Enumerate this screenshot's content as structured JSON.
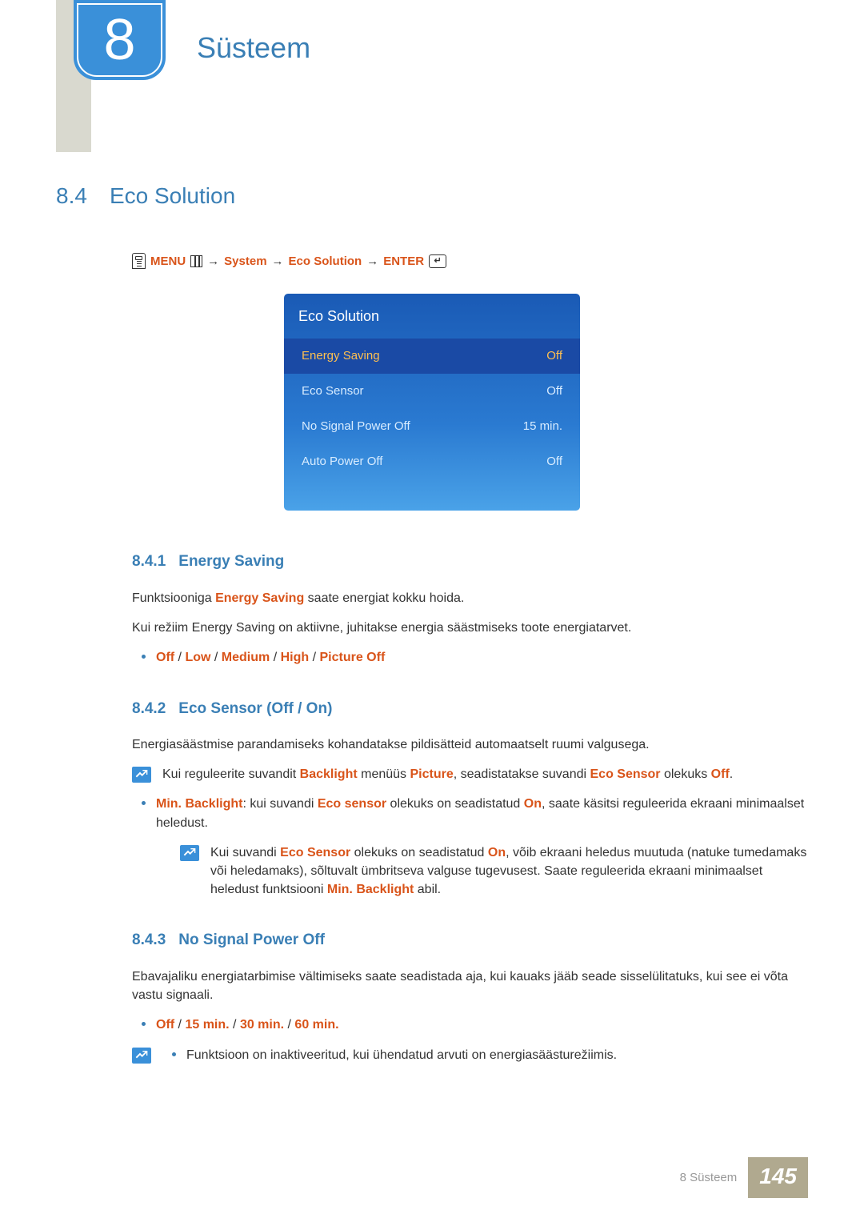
{
  "chapter": {
    "number": "8",
    "title": "Süsteem"
  },
  "section": {
    "number": "8.4",
    "title": "Eco Solution"
  },
  "menupath": {
    "menu": "MENU",
    "p1": "System",
    "p2": "Eco Solution",
    "enter": "ENTER",
    "arrow": "→"
  },
  "osd": {
    "title": "Eco Solution",
    "rows": [
      {
        "label": "Energy Saving",
        "value": "Off"
      },
      {
        "label": "Eco Sensor",
        "value": "Off"
      },
      {
        "label": "No Signal Power Off",
        "value": "15 min."
      },
      {
        "label": "Auto Power Off",
        "value": "Off"
      }
    ]
  },
  "s841": {
    "num": "8.4.1",
    "title": "Energy Saving",
    "p1a": "Funktsiooniga ",
    "p1b": "Energy Saving",
    "p1c": " saate energiat kokku hoida.",
    "p2": "Kui režiim Energy Saving on aktiivne, juhitakse energia säästmiseks toote energiatarvet.",
    "opt_off": "Off",
    "opt_low": "Low",
    "opt_medium": "Medium",
    "opt_high": "High",
    "opt_picoff": "Picture Off",
    "slash": " / "
  },
  "s842": {
    "num": "8.4.2",
    "title": "Eco Sensor (Off / On)",
    "p1": "Energiasäästmise parandamiseks kohandatakse pildisätteid automaatselt ruumi valgusega.",
    "note1a": "Kui reguleerite suvandit ",
    "note1b": "Backlight",
    "note1c": " menüüs ",
    "note1d": "Picture",
    "note1e": ", seadistatakse suvandi ",
    "note1f": "Eco Sensor",
    "note1g": " olekuks ",
    "note1h": "Off",
    "note1i": ".",
    "b1a": "Min. Backlight",
    "b1b": ": kui suvandi ",
    "b1c": "Eco sensor",
    "b1d": " olekuks on seadistatud ",
    "b1e": "On",
    "b1f": ", saate käsitsi reguleerida ekraani minimaalset heledust.",
    "note2a": "Kui suvandi ",
    "note2b": "Eco Sensor",
    "note2c": " olekuks on seadistatud ",
    "note2d": "On",
    "note2e": ", võib ekraani heledus muutuda (natuke tumedamaks või heledamaks), sõltuvalt ümbritseva valguse tugevusest. Saate reguleerida ekraani minimaalset heledust funktsiooni ",
    "note2f": "Min. Backlight",
    "note2g": " abil."
  },
  "s843": {
    "num": "8.4.3",
    "title": "No Signal Power Off",
    "p1": "Ebavajaliku energiatarbimise vältimiseks saate seadistada aja, kui kauaks jääb seade sisselülitatuks, kui see ei võta vastu signaali.",
    "opt_off": "Off",
    "opt_15": "15 min.",
    "opt_30": "30 min.",
    "opt_60": "60 min.",
    "slash": " / ",
    "note1": "Funktsioon on inaktiveeritud, kui ühendatud arvuti on energiasäästurežiimis."
  },
  "footer": {
    "label": "8 Süsteem",
    "page": "145"
  }
}
